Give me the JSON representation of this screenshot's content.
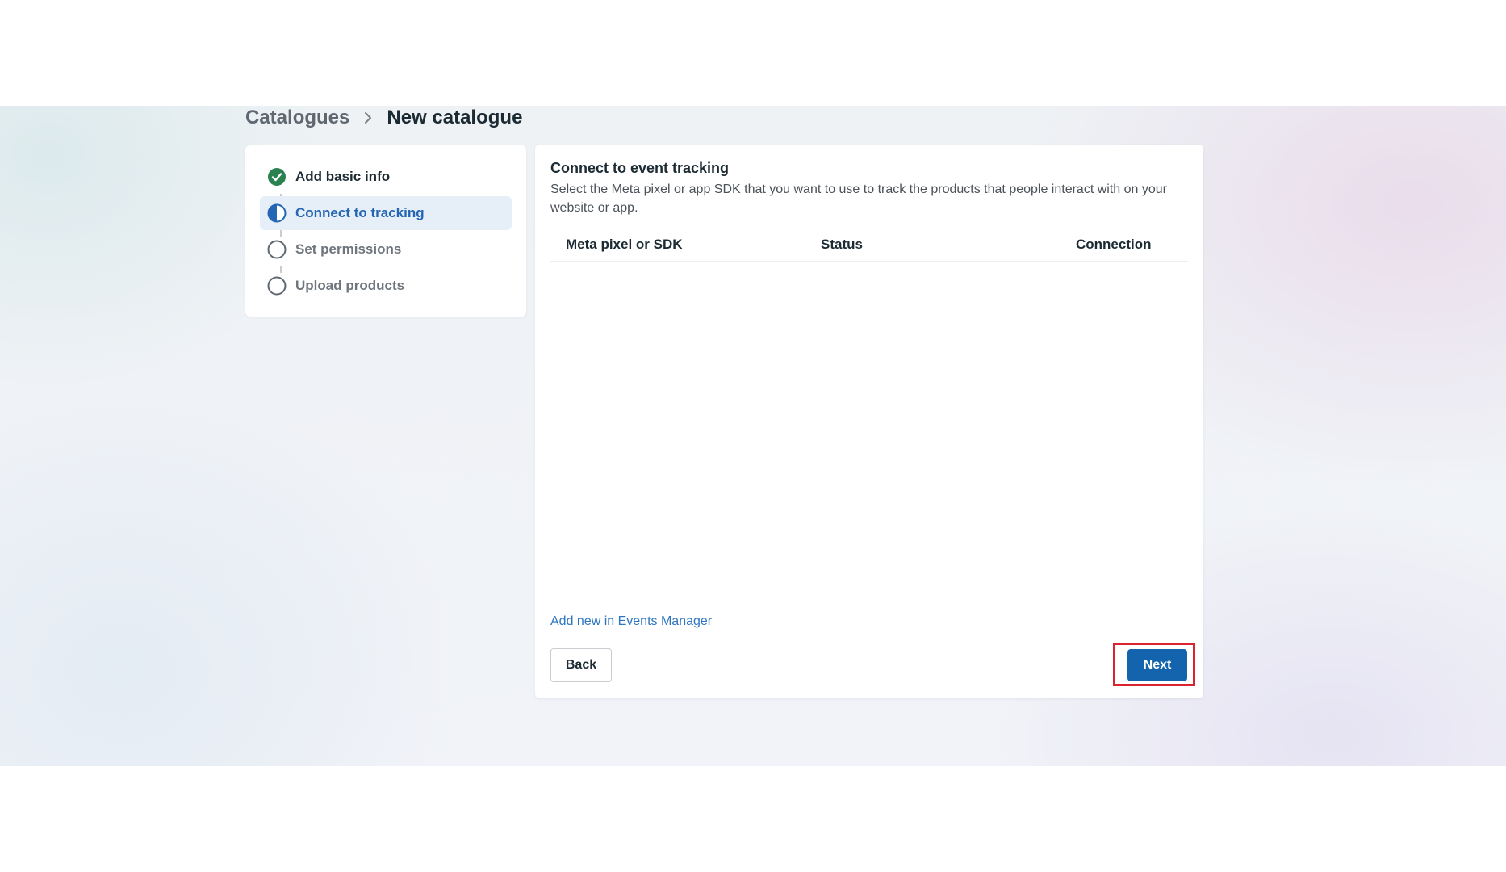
{
  "breadcrumb": {
    "parent": "Catalogues",
    "current": "New catalogue"
  },
  "steps": [
    {
      "label": "Add basic info",
      "state": "done"
    },
    {
      "label": "Connect to tracking",
      "state": "active"
    },
    {
      "label": "Set permissions",
      "state": "pending"
    },
    {
      "label": "Upload products",
      "state": "pending"
    }
  ],
  "main": {
    "title": "Connect to event tracking",
    "description": "Select the Meta pixel or app SDK that you want to use to track the products that people interact with on your website or app.",
    "table": {
      "columns": [
        "Meta pixel or SDK",
        "Status",
        "Connection"
      ],
      "rows": []
    },
    "add_link": "Add new in Events Manager",
    "back_label": "Back",
    "next_label": "Next"
  },
  "colors": {
    "accent": "#1463ad",
    "active_step": "#2466b4",
    "done_check": "#2a8250",
    "highlight": "#d9232f"
  },
  "icons": {
    "breadcrumb_separator": "chevron-right-icon",
    "step_done": "check-circle-icon",
    "step_active": "half-circle-icon",
    "step_pending": "empty-circle-icon"
  }
}
